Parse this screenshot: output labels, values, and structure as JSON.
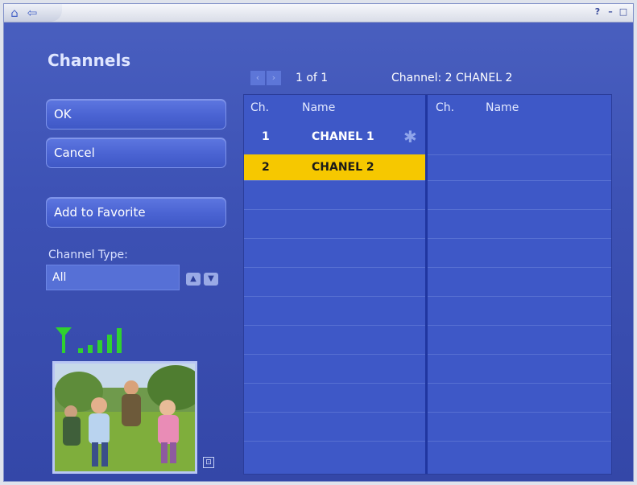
{
  "page": {
    "title": "Channels"
  },
  "buttons": {
    "ok": "OK",
    "cancel": "Cancel",
    "add_favorite": "Add to Favorite"
  },
  "channel_type": {
    "label": "Channel Type:",
    "value": "All"
  },
  "pager": {
    "text": "1 of 1",
    "current_channel": "Channel: 2 CHANEL 2"
  },
  "left_list": {
    "headers": {
      "ch": "Ch.",
      "name": "Name"
    },
    "rows": [
      {
        "ch": "1",
        "name": "CHANEL 1",
        "favorite": true
      },
      {
        "ch": "2",
        "name": "CHANEL 2",
        "selected": true
      }
    ]
  },
  "right_list": {
    "headers": {
      "ch": "Ch.",
      "name": "Name"
    }
  },
  "signal": {
    "bars": 5,
    "filled": 5,
    "color": "#2fd12f"
  },
  "colors": {
    "background": "#3d52b5",
    "selection": "#f6c800"
  },
  "icons": {
    "home": "home-icon",
    "back": "back-arrow-icon",
    "help": "help-icon",
    "minimize": "minimize-icon",
    "maximize": "maximize-icon",
    "close": "close-icon",
    "pager_prev": "chevron-left-icon",
    "pager_next": "chevron-right-icon",
    "type_up": "chevron-up-icon",
    "type_down": "chevron-down-icon",
    "favorite": "star-icon",
    "signal": "signal-antenna-icon",
    "expand": "expand-icon"
  },
  "window_controls": {
    "help": "?",
    "minimize": "–",
    "maximize": "□"
  }
}
